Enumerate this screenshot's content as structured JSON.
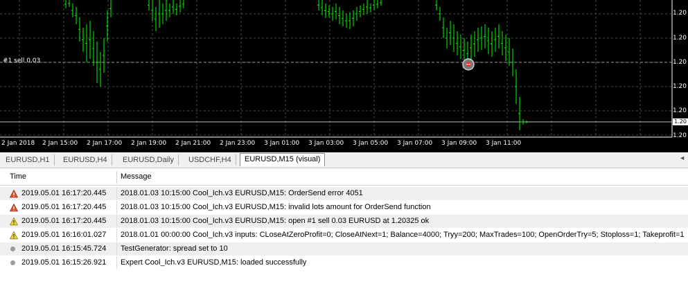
{
  "chart": {
    "order_label": "#1 sell 0.03",
    "price_labels": [
      "1.20",
      "1.20",
      "1.20",
      "1.20",
      "1.20",
      "1.20"
    ],
    "last_price": "1.20",
    "time_labels": [
      "2 Jan 2018",
      "2 Jan 15:00",
      "2 Jan 17:00",
      "2 Jan 19:00",
      "2 Jan 21:00",
      "2 Jan 23:00",
      "3 Jan 01:00",
      "3 Jan 03:00",
      "3 Jan 05:00",
      "3 Jan 07:00",
      "3 Jan 09:00",
      "3 Jan 11:00"
    ],
    "colors": {
      "background": "#000000",
      "bars": "#00ff00",
      "grid": "#4a4a4a"
    }
  },
  "tabs": [
    {
      "label": "EURUSD,H1",
      "active": false
    },
    {
      "label": "EURUSD,H4",
      "active": false
    },
    {
      "label": "EURUSD,Daily",
      "active": false
    },
    {
      "label": "USDCHF,H4",
      "active": false
    },
    {
      "label": "EURUSD,M15 (visual)",
      "active": true
    }
  ],
  "journal": {
    "columns": {
      "time": "Time",
      "message": "Message"
    },
    "rows": [
      {
        "icon": "error-icon",
        "time": "2019.05.01 16:17:20.445",
        "message": "2018.01.03 10:15:00  Cool_Ich.v3 EURUSD,M15: OrderSend error 4051"
      },
      {
        "icon": "error-icon",
        "time": "2019.05.01 16:17:20.445",
        "message": "2018.01.03 10:15:00  Cool_Ich.v3 EURUSD,M15: invalid lots amount for OrderSend function"
      },
      {
        "icon": "warning-icon",
        "time": "2019.05.01 16:17:20.445",
        "message": "2018.01.03 10:15:00  Cool_Ich.v3 EURUSD,M15: open #1 sell 0.03 EURUSD at 1.20325 ok"
      },
      {
        "icon": "warning-icon",
        "time": "2019.05.01 16:16:01.027",
        "message": "2018.01.01 00:00:00  Cool_Ich.v3 inputs: CLoseAtZeroProfit=0; CloseAtNext=1; Balance=4000; Tryy=200; MaxTrades=100; OpenOrderTry=5; Stoploss=1; Takeprofit=1"
      },
      {
        "icon": "info-dot-icon",
        "time": "2019.05.01 16:15:45.724",
        "message": "TestGenerator: spread set to 10"
      },
      {
        "icon": "info-dot-icon",
        "time": "2019.05.01 16:15:26.921",
        "message": "Expert Cool_Ich.v3 EURUSD,M15: loaded successfully"
      }
    ]
  }
}
